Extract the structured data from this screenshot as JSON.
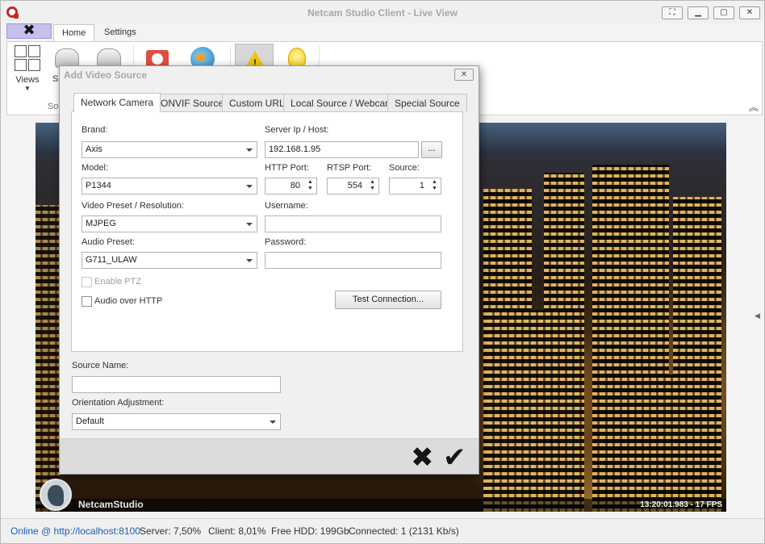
{
  "window": {
    "title": "Netcam Studio Client - Live View"
  },
  "ribbon": {
    "close_glyph": "✖",
    "tabs": [
      {
        "label": "Home"
      },
      {
        "label": "Settings"
      }
    ],
    "buttons": {
      "views": "Views",
      "partial_s": "S",
      "group_partial": "So"
    },
    "collapse_glyph": "︽"
  },
  "video": {
    "logo_text": "NetcamStudio",
    "timestamp": "13:20:01.983 - 17 FPS"
  },
  "status": {
    "online": "Online @ http://localhost:8100",
    "server": "Server: 7,50%",
    "client": "Client: 8,01%",
    "free_hdd": "Free HDD: 199Gb",
    "connected": "Connected: 1 (2131 Kb/s)"
  },
  "dialog": {
    "title": "Add Video Source",
    "close_glyph": "✕",
    "tabs": [
      {
        "label": "Network Camera"
      },
      {
        "label": "ONVIF Source"
      },
      {
        "label": "Custom URL"
      },
      {
        "label": "Local Source / Webcam"
      },
      {
        "label": "Special Source"
      }
    ],
    "active_tab": "Network Camera",
    "brand": {
      "label": "Brand:",
      "value": "Axis"
    },
    "server": {
      "label": "Server Ip / Host:",
      "value": "192.168.1.95",
      "browse": "..."
    },
    "model": {
      "label": "Model:",
      "value": "P1344"
    },
    "http_port": {
      "label": "HTTP Port:",
      "value": "80"
    },
    "rtsp_port": {
      "label": "RTSP Port:",
      "value": "554"
    },
    "source": {
      "label": "Source:",
      "value": "1"
    },
    "video_preset": {
      "label": "Video Preset / Resolution:",
      "value": "MJPEG"
    },
    "username": {
      "label": "Username:",
      "value": ""
    },
    "audio_preset": {
      "label": "Audio Preset:",
      "value": "G711_ULAW"
    },
    "password": {
      "label": "Password:",
      "value": ""
    },
    "enable_ptz": {
      "label": "Enable PTZ",
      "checked": false,
      "enabled": false
    },
    "audio_over_http": {
      "label": "Audio over HTTP",
      "checked": false
    },
    "test_connection": "Test Connection...",
    "source_name": {
      "label": "Source Name:",
      "value": ""
    },
    "orientation": {
      "label": "Orientation Adjustment:",
      "value": "Default"
    },
    "cancel_glyph": "✖",
    "ok_glyph": "✔"
  },
  "icons": [
    "app-logo-icon",
    "views-grid-icon",
    "camera-icon",
    "video-icon",
    "globe-icon",
    "warning-icon",
    "lightbulb-icon",
    "close-icon",
    "check-icon"
  ]
}
